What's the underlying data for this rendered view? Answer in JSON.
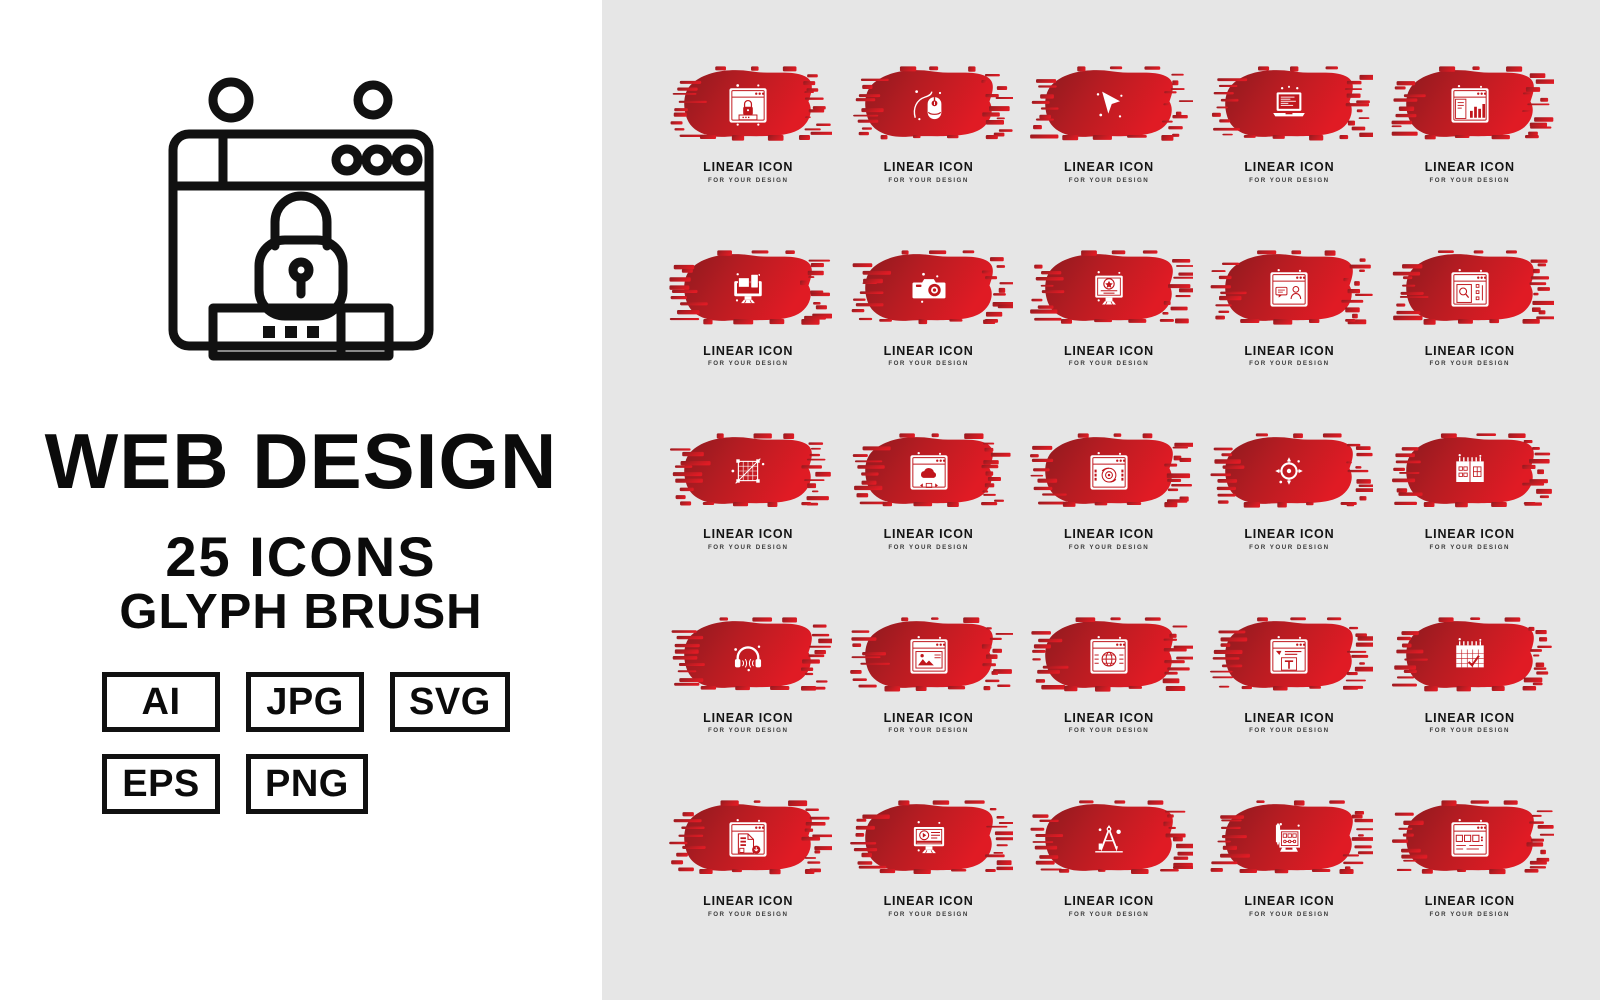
{
  "cover": {
    "hero_icon": "browser-password-lock-icon",
    "title": "WEB DESIGN",
    "count_line": "25 ICONS",
    "style_line": "GLYPH BRUSH",
    "formats": [
      {
        "label": "AI"
      },
      {
        "label": "JPG"
      },
      {
        "label": "SVG"
      },
      {
        "label": "EPS"
      },
      {
        "label": "PNG"
      }
    ]
  },
  "colors": {
    "panel_left_bg": "#ffffff",
    "panel_right_bg": "#e6e6e6",
    "brush_dark": "#8f1a1f",
    "brush_mid": "#b71c22",
    "brush_bright": "#e01b24",
    "glyph": "#ffffff",
    "text": "#141414"
  },
  "grid": {
    "columns": 5,
    "rows": 5,
    "label": "LINEAR ICON",
    "sublabel": "FOR YOUR DESIGN",
    "items": [
      {
        "icon": "browser-password-lock-icon"
      },
      {
        "icon": "computer-mouse-icon"
      },
      {
        "icon": "cursor-arrow-icon"
      },
      {
        "icon": "laptop-code-icon"
      },
      {
        "icon": "analytics-dashboard-icon"
      },
      {
        "icon": "desktop-workstation-icon"
      },
      {
        "icon": "photo-camera-icon"
      },
      {
        "icon": "monitor-star-rating-icon"
      },
      {
        "icon": "browser-chat-user-icon"
      },
      {
        "icon": "browser-document-search-icon"
      },
      {
        "icon": "grid-transform-icon"
      },
      {
        "icon": "browser-cloud-icon"
      },
      {
        "icon": "browser-media-player-icon"
      },
      {
        "icon": "target-crosshair-icon"
      },
      {
        "icon": "calendar-grid-icon"
      },
      {
        "icon": "headphones-icon"
      },
      {
        "icon": "browser-image-icon"
      },
      {
        "icon": "browser-globe-icon"
      },
      {
        "icon": "browser-text-tool-icon"
      },
      {
        "icon": "calendar-check-icon"
      },
      {
        "icon": "browser-file-download-icon"
      },
      {
        "icon": "monitor-video-play-icon"
      },
      {
        "icon": "compass-divider-icon"
      },
      {
        "icon": "drawing-tablet-icon"
      },
      {
        "icon": "browser-web-form-icon"
      }
    ]
  }
}
